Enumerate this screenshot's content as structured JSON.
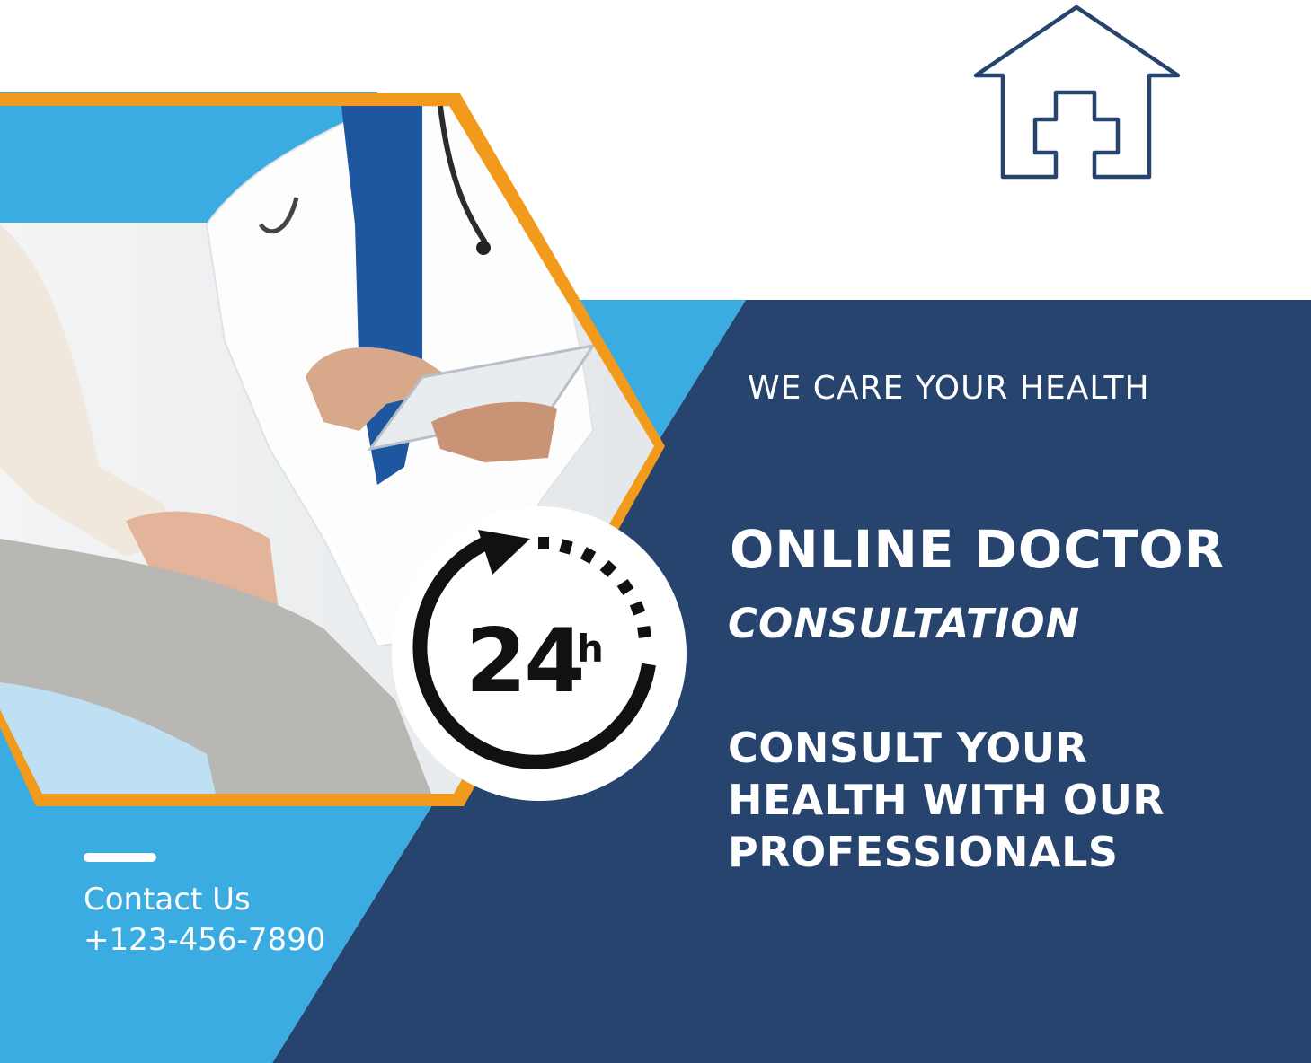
{
  "colors": {
    "navy": "#27446f",
    "sky_blue": "#3aace2",
    "orange": "#f29a1c",
    "white": "#ffffff",
    "icon_stroke": "#27446f"
  },
  "logo": {
    "icon": "house-medical-cross-icon"
  },
  "photo": {
    "subject": "doctor-with-tablet-and-patient"
  },
  "badge": {
    "icon": "clock-24h-icon",
    "number": "24",
    "unit": "h"
  },
  "hero": {
    "tagline": "WE CARE YOUR HEALTH",
    "title": "ONLINE DOCTOR",
    "subtitle": "CONSULTATION",
    "body_lines": [
      "CONSULT YOUR",
      "HEALTH WITH OUR",
      "PROFESSIONALS"
    ]
  },
  "contact": {
    "label": "Contact Us",
    "phone": "+123-456-7890"
  }
}
